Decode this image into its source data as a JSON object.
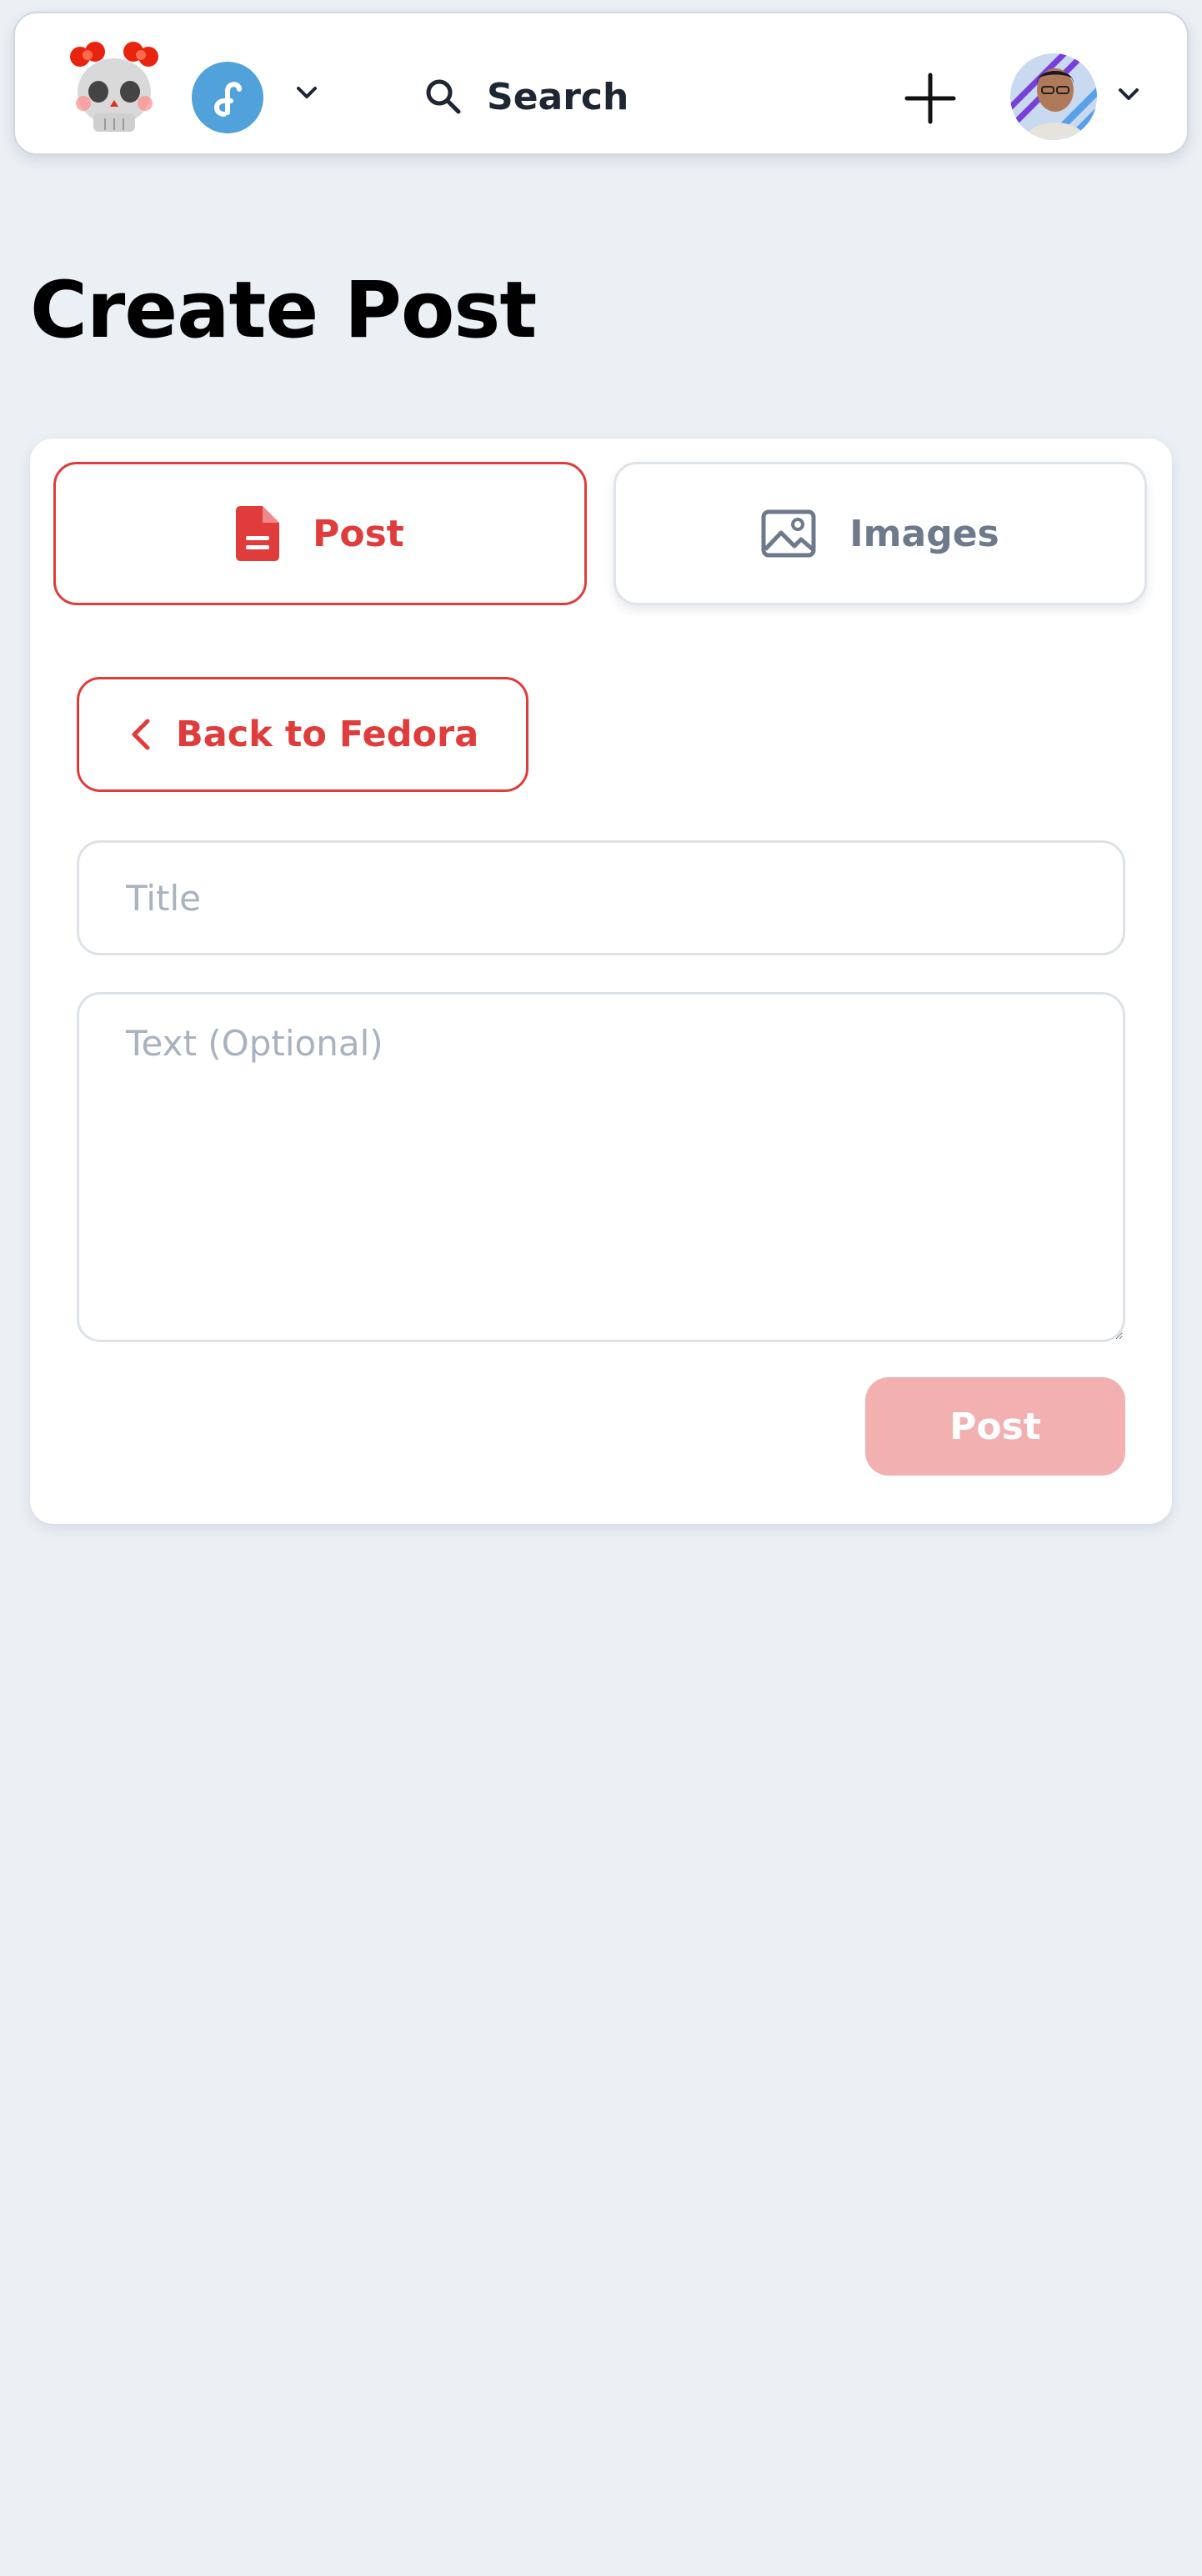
{
  "header": {
    "search_label": "Search"
  },
  "page": {
    "title": "Create Post"
  },
  "tabs": [
    {
      "label": "Post",
      "icon": "document-icon",
      "active": true
    },
    {
      "label": "Images",
      "icon": "image-icon",
      "active": false
    }
  ],
  "form": {
    "back_label": "Back to Fedora",
    "title_placeholder": "Title",
    "title_value": "",
    "text_placeholder": "Text (Optional)",
    "text_value": "",
    "submit_label": "Post"
  },
  "colors": {
    "accent": "#e03c3c",
    "accent_disabled": "#f3b0b0",
    "background": "#ebf0f5",
    "muted_text": "#6e7a8c",
    "community_blue": "#51a2da"
  }
}
